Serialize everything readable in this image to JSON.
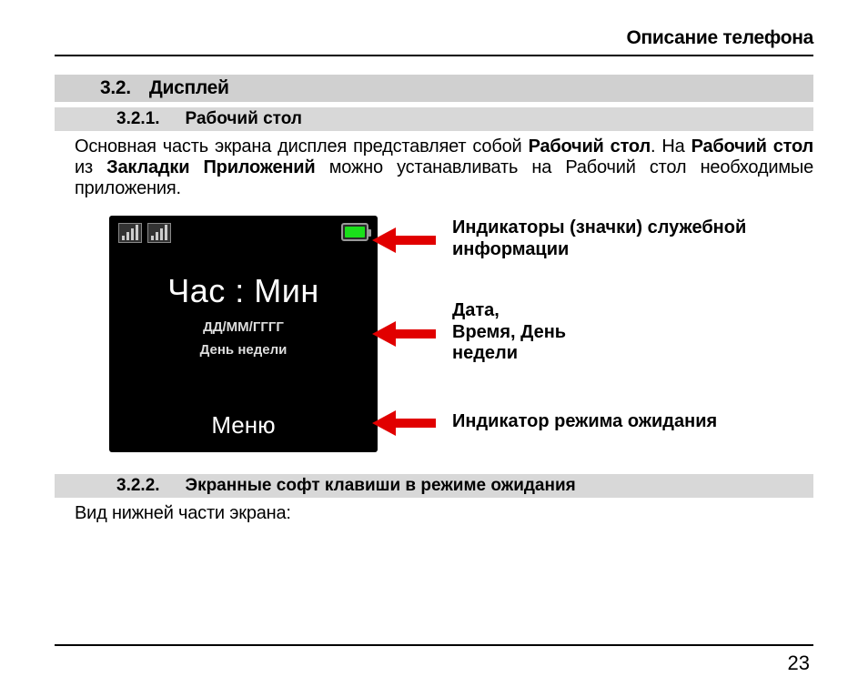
{
  "header": {
    "title": "Описание телефона"
  },
  "section": {
    "num": "3.2.",
    "title": "Дисплей"
  },
  "sub1": {
    "num": "3.2.1.",
    "title": "Рабочий стол"
  },
  "para1": {
    "t1": "Основная часть экрана дисплея представляет собой ",
    "b1": "Рабочий стол",
    "t2": ". На ",
    "b2": "Рабо­чий стол",
    "t3": " из ",
    "b3": "Закладки Приложений",
    "t4": " можно устанавливать на Рабочий стол необходимые приложения."
  },
  "screen": {
    "clock": "Час : Мин",
    "date": "ДД/ММ/ГГГГ",
    "day": "День недели",
    "menu": "Меню"
  },
  "callouts": {
    "c1": "Индикаторы (значки) служебной информации",
    "c2": "Дата,\nВремя, День\nнедели",
    "c3": "Индикатор режима ожидания"
  },
  "sub2": {
    "num": "3.2.2.",
    "title": "Экранные софт клавиши в режиме ожидания"
  },
  "para2": "Вид нижней части экрана:",
  "page": "23"
}
